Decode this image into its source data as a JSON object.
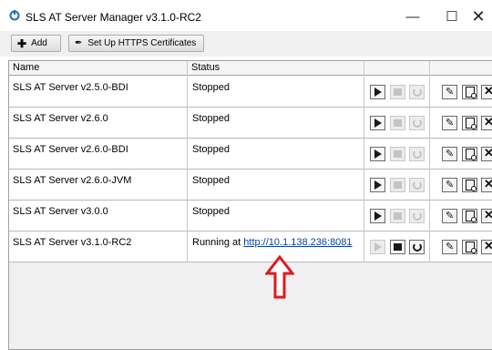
{
  "window": {
    "title": "SLS AT Server Manager v3.1.0-RC2",
    "minimize_glyph": "—",
    "maximize_glyph": "☐",
    "close_glyph": "✕"
  },
  "toolbar": {
    "add_label": "Add",
    "https_label": "Set Up HTTPS Certificates"
  },
  "table": {
    "columns": [
      "Name",
      "Status",
      "",
      ""
    ],
    "rows": [
      {
        "name": "SLS AT Server v2.5.0-BDI",
        "status": "Stopped",
        "link": ""
      },
      {
        "name": "SLS AT Server v2.6.0",
        "status": "Stopped",
        "link": ""
      },
      {
        "name": "SLS AT Server v2.6.0-BDI",
        "status": "Stopped",
        "link": ""
      },
      {
        "name": "SLS AT Server v2.6.0-JVM",
        "status": "Stopped",
        "link": ""
      },
      {
        "name": "SLS AT Server v3.0.0",
        "status": "Stopped",
        "link": ""
      },
      {
        "name": "SLS AT Server v3.1.0-RC2",
        "status": "Running at ",
        "link": "http://10.1.138.236:8081"
      }
    ]
  },
  "colors": {
    "link": "#0a3fa8",
    "arrow": "#e0191f",
    "app_icon": "#1f6fb0"
  }
}
